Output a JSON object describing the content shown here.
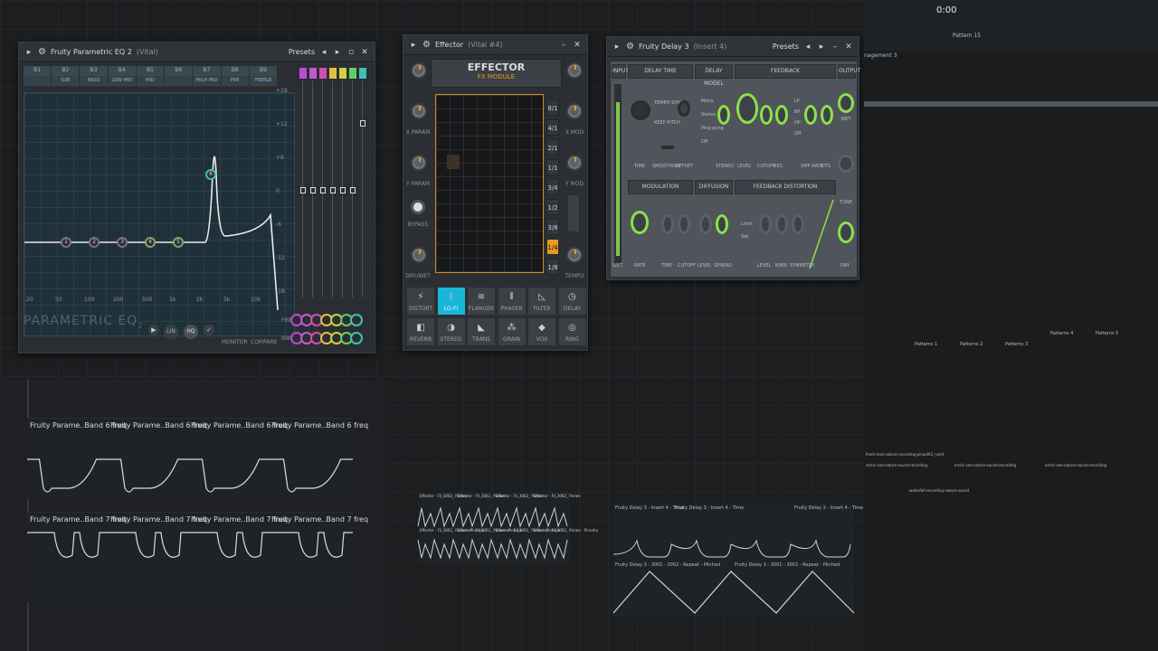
{
  "eq": {
    "title": "Fruity Parametric EQ 2",
    "subtitle": "(Vital)",
    "presets": "Presets",
    "bands": [
      "B1",
      "B2",
      "B3",
      "B4",
      "B5",
      "B6",
      "B7",
      "B8",
      "B9"
    ],
    "band_names": [
      "",
      "SUB",
      "BASS",
      "LOW MID",
      "MID",
      "",
      "HIGH MID",
      "PRE",
      "TREBLE"
    ],
    "nodes": [
      "1",
      "2",
      "3",
      "4",
      "5",
      "6",
      "7"
    ],
    "db_ticks": [
      "+18",
      "+12",
      "+6",
      "0",
      "-6",
      "-12",
      "-18"
    ],
    "freq_ticks": [
      "20",
      "50",
      "100",
      "200",
      "500",
      "1k",
      "2k",
      "5k",
      "10k"
    ],
    "brand": "PARAMETRIC EQ",
    "brand_num": "2",
    "buttons": {
      "lin": "LIN",
      "hq": "HQ",
      "monitor": "MONITOR",
      "compare": "COMPARE",
      "freq": "FREQ",
      "bw": "BW"
    },
    "slider_colors": [
      "#b94dd6",
      "#c05ad0",
      "#d04fb0",
      "#e0c040",
      "#d0d040",
      "#60d060",
      "#40c0b0"
    ]
  },
  "effector": {
    "title": "Effector",
    "subtitle": "(Vital #4)",
    "brand": "EFFECTOR",
    "module": "FX MODULE",
    "left_labels": [
      "X PARAM",
      "Y PARAM",
      "BYPASS",
      "DRY/WET"
    ],
    "right_labels": [
      "X MOD",
      "Y MOD",
      "TEMPO"
    ],
    "ratios": [
      "8/1",
      "4/1",
      "2/1",
      "1/1",
      "3/4",
      "1/2",
      "3/8",
      "1/4",
      "1/8"
    ],
    "selected_ratio": "1/4",
    "effects_row1": [
      "DISTORT",
      "LO-FI",
      "FLANGER",
      "PHASER",
      "FILTER",
      "DELAY"
    ],
    "effects_row2": [
      "REVERB",
      "STEREO",
      "TRANS",
      "GRAIN",
      "VOX",
      "RING"
    ],
    "selected_effect": "LO-FI"
  },
  "delay": {
    "title": "Fruity Delay 3",
    "subtitle": "(Insert 4)",
    "presets": "Presets",
    "sections_top": [
      "INPUT",
      "DELAY TIME",
      "DELAY MODEL",
      "FEEDBACK",
      "OUTPUT"
    ],
    "sections_mid": [
      "MODULATION",
      "DIFFUSION",
      "FEEDBACK DISTORTION"
    ],
    "time_opts": [
      "TEMPO SYNC",
      "KEEP PITCH"
    ],
    "model_opts": [
      "Mono",
      "Stereo",
      "Ping pong",
      "Off"
    ],
    "labels_top": [
      "TIME",
      "SMOOTHING",
      "OFFSET",
      "STEREO",
      "LEVEL",
      "CUTOFF",
      "RES",
      "SMP RATE",
      "BITS"
    ],
    "labels_bottom": [
      "WET",
      "RATE",
      "TIME",
      "CUTOFF",
      "LEVEL",
      "SPREAD",
      "LEVEL",
      "KNEE",
      "SYMMETRY",
      "DRY"
    ],
    "tone": "TONE",
    "wet": "WET",
    "limit_opts": [
      "Limit",
      "Sat"
    ],
    "filter_opts": [
      "LP",
      "BP",
      "HP",
      "Off"
    ]
  },
  "automation": {
    "band6": [
      "Fruity Parame..Band 6 freq",
      "Fruity Parame..Band 6 freq",
      "Fruity Parame..Band 6 freq",
      "Fruity Parame..Band 6 freq"
    ],
    "band7": [
      "Fruity Parame..Band 7 freq",
      "Fruity Parame..Band 7 freq",
      "Fruity Parame..Band 7 freq",
      "Fruity Parame..Band 7 freq"
    ],
    "effector_clips": [
      "Effector - Fil_3002_ Param",
      "Effector - Fil_3002_ Param",
      "Effector - Fil_3002_ Param",
      "Effector - Fil_3002_ Param"
    ],
    "effector_clips2": [
      "Effector - Fil_3002_ Param - Piranha",
      "Effector - Fil_3002_ Param - Piranha",
      "Effector - Fil_3002_ Param - Piranha",
      "Effector - Fil_3002_ Param - Piranha"
    ],
    "delay_clips": [
      "Fruity Delay 3 - Insert 4 - Time",
      "Fruity Delay 3 - Insert 4 - Time",
      "Fruity Delay 3 - Insert 4 - Time"
    ],
    "delay_clips2": [
      "Fruity Delay 3 - 3001 - 3002 - Repeat - Pitched",
      "Fruity Delay 3 - 3001 - 3002 - Repeat - Pitched"
    ]
  },
  "playlist": {
    "header_text": "nagement 3",
    "pattern": "Pattern 15",
    "clips": [
      "Patterns 1",
      "Patterns 2",
      "Patterns 3",
      "Patterns 4",
      "Patterns 5"
    ],
    "bottom_clips": [
      "fresh-mail-nature-recording-pinaufit2_nexit",
      "arctic-sea-nature-sound-recording",
      "arctic-sea-nature-sound-recording",
      "arctic-sea-nature-sound-recording",
      "waterfall-recording-nature-sound"
    ]
  }
}
